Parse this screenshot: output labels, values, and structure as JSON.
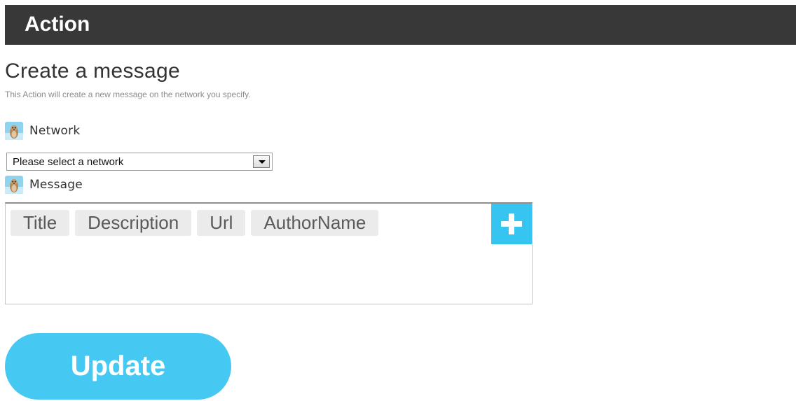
{
  "header": {
    "title": "Action"
  },
  "page": {
    "title": "Create a message",
    "subtitle": "This Action will create a new message on the network you specify."
  },
  "network_field": {
    "label": "Network",
    "icon": "meerkat-icon",
    "select_value": "Please select a network"
  },
  "message_field": {
    "label": "Message",
    "icon": "meerkat-icon",
    "tags": [
      "Title",
      "Description",
      "Url",
      "AuthorName"
    ],
    "add_icon": "plus-icon"
  },
  "update_button": {
    "label": "Update"
  },
  "colors": {
    "header_bg": "#383838",
    "accent": "#45c8f2"
  }
}
